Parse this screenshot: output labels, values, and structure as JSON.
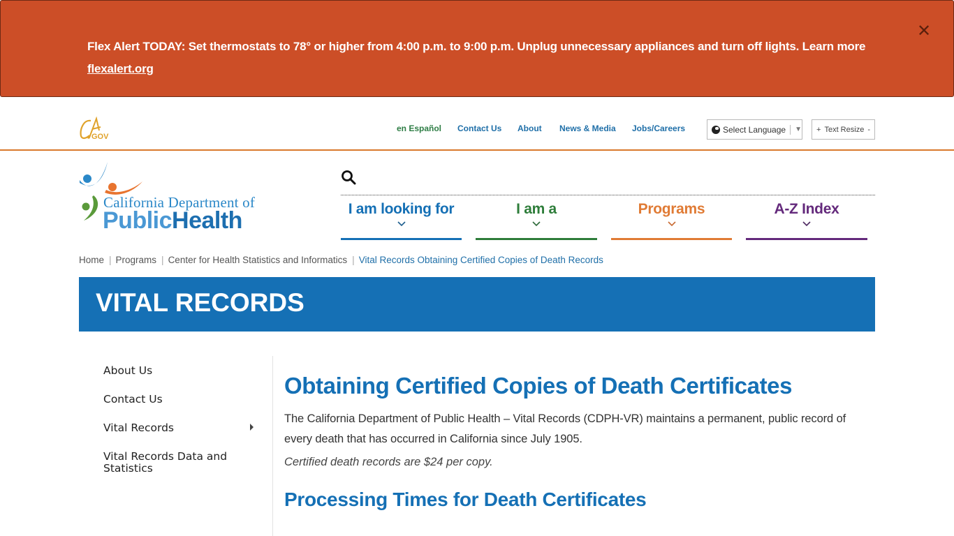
{
  "alert": {
    "message": "Flex Alert TODAY: Set thermostats to 78° or higher from 4:00 p.m. to 9:00 p.m. Unplug unnecessary appliances and turn off lights. Learn more",
    "link_text": "flexalert.org",
    "close_icon": "close-icon",
    "close_glyph": "✕",
    "background_color": "#cc4e27"
  },
  "utility": {
    "ca_logo": {
      "script": "CA",
      "suffix": ".GOV"
    },
    "links": [
      {
        "label": "en Español",
        "color": "#2e7d45"
      },
      {
        "label": "Contact Us",
        "color": "#1f6fa8"
      },
      {
        "label": "About",
        "color": "#1f6fa8"
      },
      {
        "label": "News & Media",
        "color": "#1f6fa8"
      },
      {
        "label": "Jobs/Careers",
        "color": "#1f6fa8"
      }
    ],
    "language_select": {
      "value": "Select Language",
      "icon": "globe-icon",
      "arrow": "▼"
    },
    "text_resize": {
      "label": "Text Resize",
      "increase": "+",
      "decrease": "-"
    }
  },
  "logo": {
    "line1": "California Department of",
    "line2_a": "Public",
    "line2_b": "Health"
  },
  "search": {
    "icon": "search-icon"
  },
  "main_nav": [
    {
      "label": "I am looking for",
      "color": "#1570b5"
    },
    {
      "label": "I am a",
      "color": "#2e7d3a"
    },
    {
      "label": "Programs",
      "color": "#e07b35"
    },
    {
      "label": "A-Z Index",
      "color": "#642a7c"
    }
  ],
  "breadcrumb": [
    {
      "label": "Home"
    },
    {
      "label": "Programs"
    },
    {
      "label": "Center for Health Statistics and Informatics"
    },
    {
      "label": "Vital Records Obtaining Certified Copies of Death Records",
      "current": true
    }
  ],
  "page_banner": {
    "title": "VITAL RECORDS",
    "color": "#1570b5"
  },
  "side_nav": [
    {
      "label": "About Us"
    },
    {
      "label": "Contact Us"
    },
    {
      "label": "Vital Records",
      "has_submenu": true
    },
    {
      "label": "Vital Records Data and Statistics"
    }
  ],
  "content": {
    "title": "Obtaining Certified Copies of Death Certificates",
    "lead": "The California Department of Public Health – Vital Records (CDPH-VR) maintains a permanent, public record of every death that has occurred in California since July 1905.",
    "price_note": "Certified death records are $24 per copy.",
    "subheading": "Processing Times for Death Certificates"
  }
}
